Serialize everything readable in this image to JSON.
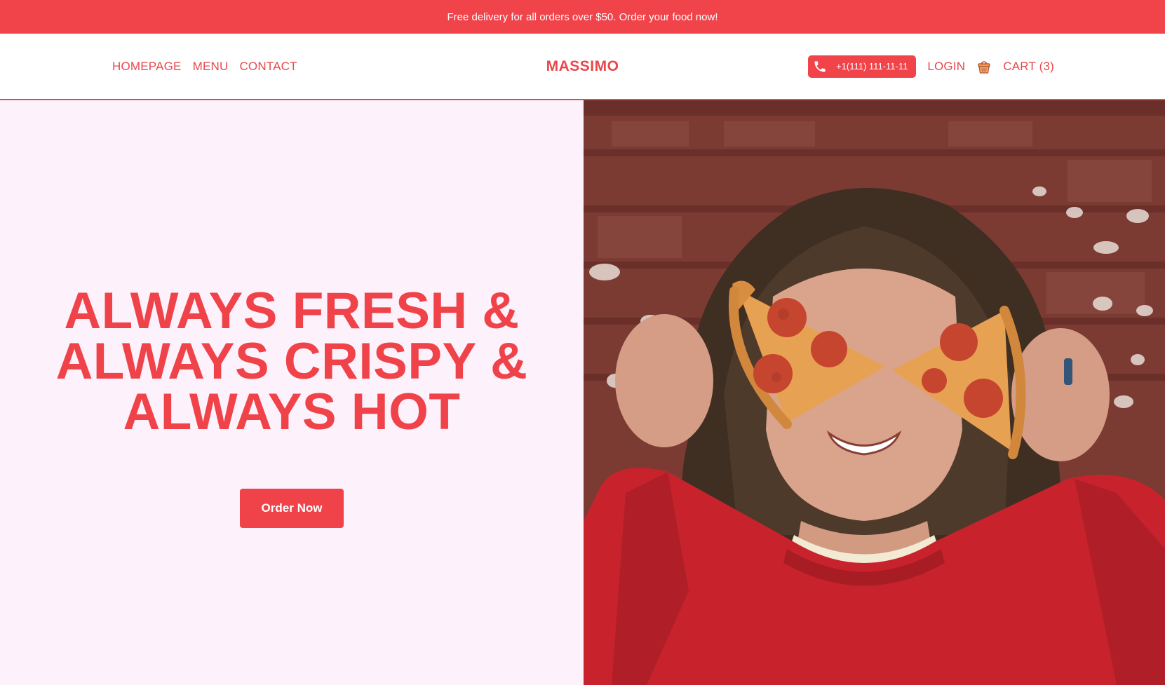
{
  "promo": {
    "text": "Free delivery for all orders over $50. Order your food now!"
  },
  "nav": {
    "links": [
      {
        "label": "HOMEPAGE"
      },
      {
        "label": "MENU"
      },
      {
        "label": "CONTACT"
      }
    ],
    "brand": "MASSIMO",
    "phone": "+1(111) 111-11-11",
    "login": "LOGIN",
    "cart": "CART (3)"
  },
  "hero": {
    "title_lines": [
      "ALWAYS FRESH &",
      "ALWAYS CRISPY &",
      "ALWAYS HOT"
    ],
    "cta": "Order Now"
  },
  "icons": {
    "phone": "phone-icon",
    "cart": "shopping-basket-icon"
  },
  "colors": {
    "accent": "#ef4349",
    "hero_background": "#fdf1fc",
    "sweater": "#c8232c"
  }
}
